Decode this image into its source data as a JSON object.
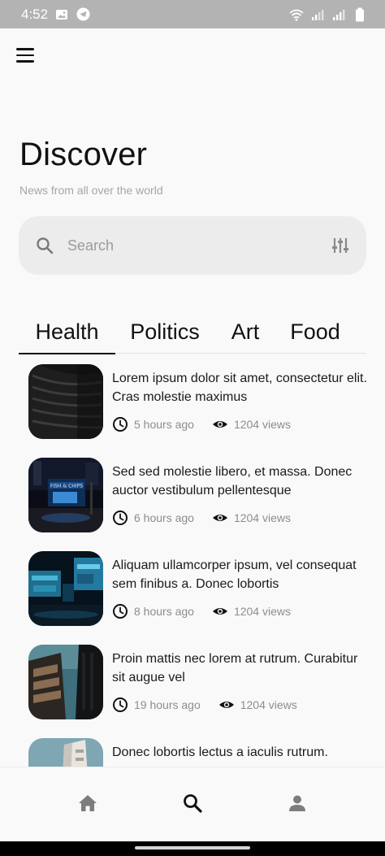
{
  "status_bar": {
    "time": "4:52",
    "icons": [
      "gallery-icon",
      "telegram-icon",
      "wifi-icon",
      "signal-icon",
      "signal-icon",
      "battery-icon"
    ]
  },
  "header": {
    "menu_icon": "hamburger-menu-icon",
    "title": "Discover",
    "subtitle": "News from all over the world"
  },
  "search": {
    "placeholder": "Search",
    "value": "",
    "search_icon": "search-icon",
    "filter_icon": "sliders-icon"
  },
  "tabs": [
    {
      "label": "Health",
      "active": true
    },
    {
      "label": "Politics",
      "active": false
    },
    {
      "label": "Art",
      "active": false
    },
    {
      "label": "Food",
      "active": false
    }
  ],
  "articles": [
    {
      "title": "Lorem ipsum dolor sit amet, consectetur elit. Cras molestie maximus",
      "time": "5 hours ago",
      "views": "1204 views",
      "thumb": "dark-building"
    },
    {
      "title": "Sed sed molestie libero, et massa. Donec auctor vestibulum pellentesque",
      "time": "6 hours ago",
      "views": "1204 views",
      "thumb": "night-shop"
    },
    {
      "title": "Aliquam ullamcorper ipsum, vel consequat sem finibus a. Donec lobortis",
      "time": "8 hours ago",
      "views": "1204 views",
      "thumb": "neon-billboards"
    },
    {
      "title": "Proin mattis nec lorem at rutrum. Curabitur sit augue vel",
      "time": "19 hours ago",
      "views": "1204 views",
      "thumb": "tower-sky"
    },
    {
      "title": "Donec lobortis lectus a iaculis rutrum.",
      "time": "",
      "views": "",
      "thumb": "white-building"
    }
  ],
  "bottom_nav": {
    "items": [
      "home-icon",
      "search-icon",
      "profile-icon"
    ],
    "active": "search-icon"
  },
  "colors": {
    "status_bar": "#b3b3b3",
    "background": "#f9f9f9",
    "search_bg": "#ececec",
    "text": "#111111",
    "muted": "#8d8d8d"
  }
}
